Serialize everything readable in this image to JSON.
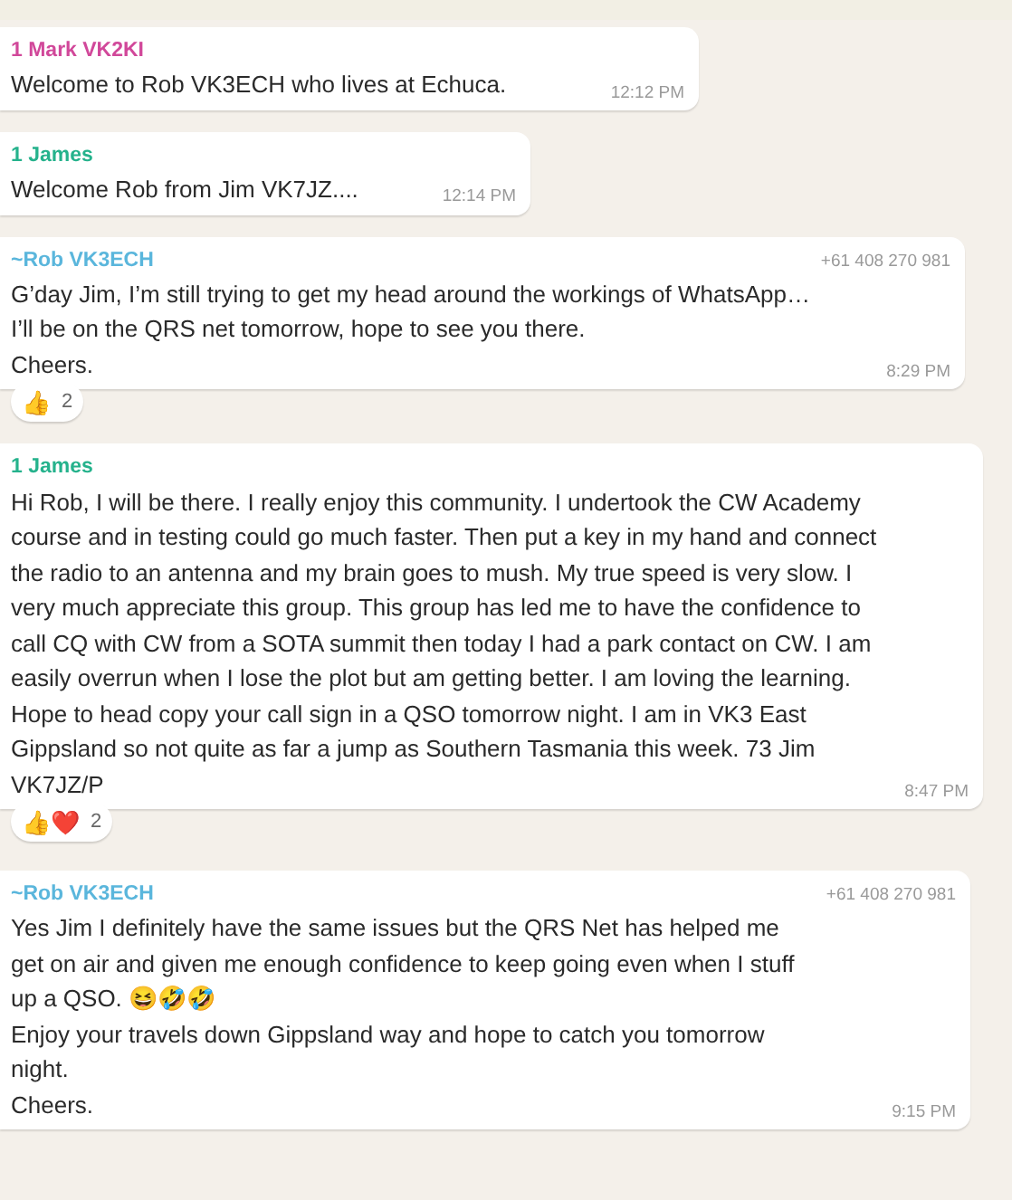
{
  "messages": [
    {
      "sender": "1 Mark VK2KI",
      "color": "#d1489a",
      "paragraphs": [
        "Welcome to Rob VK3ECH who lives at Echuca."
      ],
      "time": "12:12 PM"
    },
    {
      "sender": "1 James",
      "color": "#25b28c",
      "paragraphs": [
        "Welcome Rob from Jim VK7JZ...."
      ],
      "time": "12:14 PM"
    },
    {
      "sender": "~Rob VK3ECH",
      "color": "#5ab6dc",
      "phone": "+61 408 270 981",
      "paragraphs": [
        "G’day Jim, I’m still trying to get my head around the workings of WhatsApp…",
        "I’ll be on the QRS net tomorrow, hope to see you there.",
        "Cheers."
      ],
      "time": "8:29 PM",
      "reaction": {
        "emojis": "👍",
        "count": "2"
      }
    },
    {
      "sender": "1 James",
      "color": "#25b28c",
      "paragraphs": [
        "Hi Rob, I will be there.  I really enjoy this community.  I undertook the CW Academy course and in testing could go much faster.  Then put a key in my hand and connect the radio to an antenna and my brain goes to mush.  My true speed is very slow.  I very much appreciate this group.  This group has led me to have the confidence to call CQ with CW from a SOTA summit then today I had a park contact on CW.  I am easily overrun when I lose the plot but am getting better.  I am loving the learning.  Hope to head copy your call sign in a QSO tomorrow night.  I am in VK3 East Gippsland so not quite as far a jump as Southern Tasmania this week. 73 Jim VK7JZ/P"
      ],
      "time": "8:47 PM",
      "reaction": {
        "emojis": "👍❤️",
        "count": "2"
      }
    },
    {
      "sender": "~Rob VK3ECH",
      "color": "#5ab6dc",
      "phone": "+61 408 270 981",
      "paragraphs": [
        "Yes Jim I definitely have the same issues but the QRS Net has helped me get on air and given me enough confidence to keep going even when I stuff up a QSO. 😆🤣🤣",
        "Enjoy your travels down Gippsland way and hope to catch you tomorrow night.",
        "Cheers."
      ],
      "time": "9:15 PM"
    }
  ]
}
